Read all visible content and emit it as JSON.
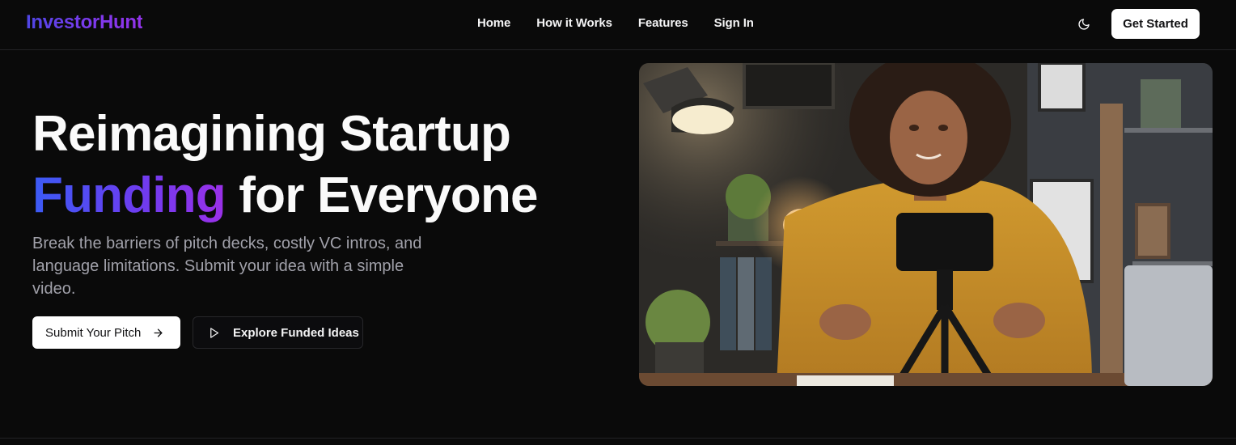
{
  "header": {
    "logo": "InvestorHunt",
    "nav": [
      {
        "label": "Home"
      },
      {
        "label": "How it Works"
      },
      {
        "label": "Features"
      },
      {
        "label": "Sign In"
      }
    ],
    "theme_toggle_icon": "moon-icon",
    "cta_label": "Get Started"
  },
  "hero": {
    "title_line1": "Reimagining Startup",
    "title_accent": "Funding",
    "title_rest": " for Everyone",
    "subtitle": "Break the barriers of pitch decks, costly VC intros, and language limitations. Submit your idea with a simple video.",
    "primary_button": {
      "label": "Submit Your Pitch",
      "icon": "arrow-right-icon"
    },
    "secondary_button": {
      "label": "Explore Funded Ideas",
      "icon": "play-icon"
    }
  },
  "colors": {
    "background": "#0a0a0a",
    "accent_gradient_start": "#3b5bf5",
    "accent_gradient_end": "#9b30e8",
    "button_light": "#ffffff"
  }
}
